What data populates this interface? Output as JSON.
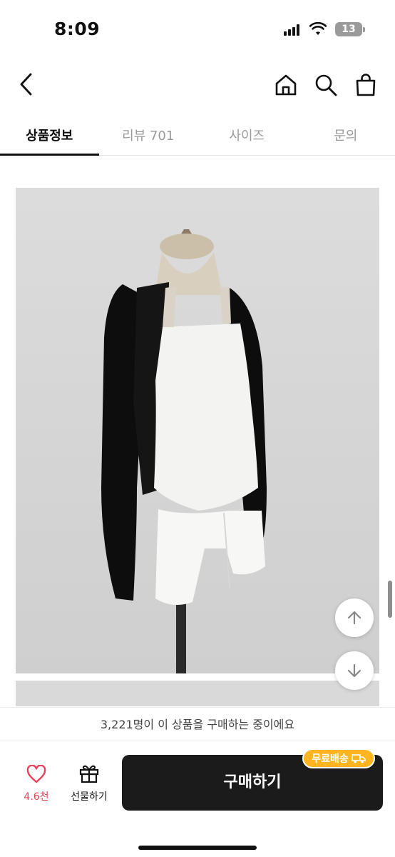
{
  "status_bar": {
    "time": "8:09",
    "battery": "13"
  },
  "header": {
    "back_icon": "chevron-left-icon",
    "home_icon": "home-icon",
    "search_icon": "search-icon",
    "bag_icon": "shopping-bag-icon"
  },
  "tabs": [
    {
      "label": "상품정보",
      "active": true
    },
    {
      "label": "리뷰 701",
      "active": false
    },
    {
      "label": "사이즈",
      "active": false
    },
    {
      "label": "문의",
      "active": false
    }
  ],
  "product_image": {
    "description_icon": "product-photo",
    "background": "#d6d6d6"
  },
  "fab": {
    "up_icon": "arrow-up-icon",
    "down_icon": "arrow-down-icon"
  },
  "notice": {
    "text": "3,221명이 이 상품을 구매하는 중이에요"
  },
  "bottom_bar": {
    "like_icon": "heart-icon",
    "like_count": "4.6천",
    "gift_icon": "gift-icon",
    "gift_label": "선물하기",
    "buy_label": "구매하기",
    "shipping_badge": "무료배송",
    "shipping_icon": "truck-icon"
  },
  "colors": {
    "accent_like": "#e8425a",
    "badge": "#ffb51f",
    "buy_button": "#1b1b1b"
  }
}
